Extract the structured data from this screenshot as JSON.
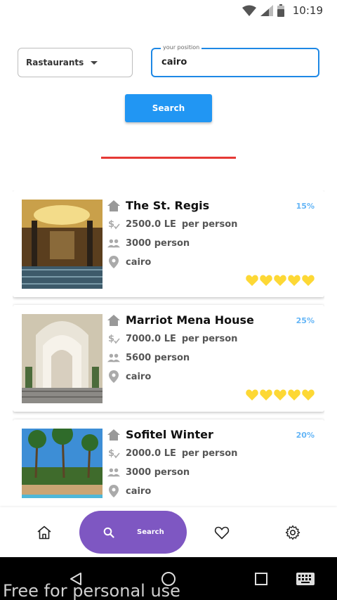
{
  "status_bar": {
    "time": "10:19"
  },
  "filters": {
    "category": "Rastaurants",
    "position_label": "your position",
    "position_value": "cairo"
  },
  "search_button": "Search",
  "colors": {
    "accent": "#2196f3",
    "divider": "#e53935",
    "nav_active": "#7e57c2",
    "hearts": "#fdd835",
    "discount": "#64b5f6"
  },
  "places": [
    {
      "name": "The St. Regis",
      "price": "2500.0 LE",
      "price_unit": "per person",
      "capacity": "3000 person",
      "location": "cairo",
      "discount": "15%",
      "rating": 5
    },
    {
      "name": "Marriot Mena House",
      "price": "7000.0 LE",
      "price_unit": "per person",
      "capacity": "5600 person",
      "location": "cairo",
      "discount": "25%",
      "rating": 5
    },
    {
      "name": "Sofitel Winter",
      "price": "2000.0 LE",
      "price_unit": "per person",
      "capacity": "3000 person",
      "location": "cairo",
      "discount": "20%",
      "rating": 5
    }
  ],
  "icons": {
    "title": "home-icon",
    "price": "money-icon",
    "capacity": "people-icon",
    "location": "location-pin-icon"
  },
  "bottom_nav": {
    "home_icon": "home-icon",
    "search_label": "Search",
    "favorites_icon": "heart-icon",
    "settings_icon": "gear-icon"
  },
  "watermark": "Free for personal use"
}
